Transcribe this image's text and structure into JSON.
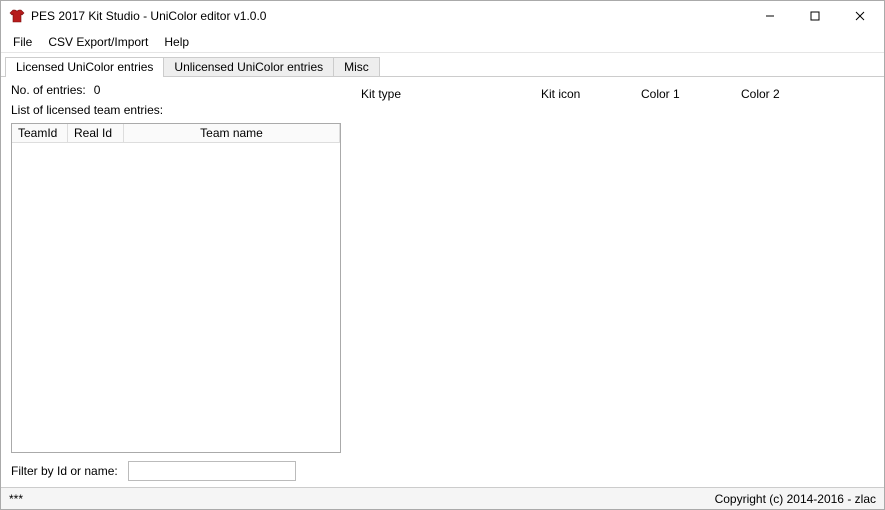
{
  "window": {
    "title": "PES 2017 Kit Studio - UniColor editor v1.0.0"
  },
  "menubar": {
    "file": "File",
    "csv": "CSV Export/Import",
    "help": "Help"
  },
  "tabs": {
    "licensed": "Licensed UniColor entries",
    "unlicensed": "Unlicensed UniColor entries",
    "misc": "Misc",
    "active": "licensed"
  },
  "left": {
    "num_entries_label": "No. of entries:",
    "num_entries_value": "0",
    "list_title": "List of licensed team entries:",
    "columns": {
      "teamid": "TeamId",
      "realid": "Real Id",
      "teamname": "Team name"
    },
    "filter_label": "Filter by Id or name:",
    "filter_value": ""
  },
  "right": {
    "columns": {
      "kit_type": "Kit type",
      "kit_icon": "Kit icon",
      "color1": "Color 1",
      "color2": "Color 2"
    }
  },
  "statusbar": {
    "left": "***",
    "right": "Copyright (c) 2014-2016 - zlac"
  }
}
